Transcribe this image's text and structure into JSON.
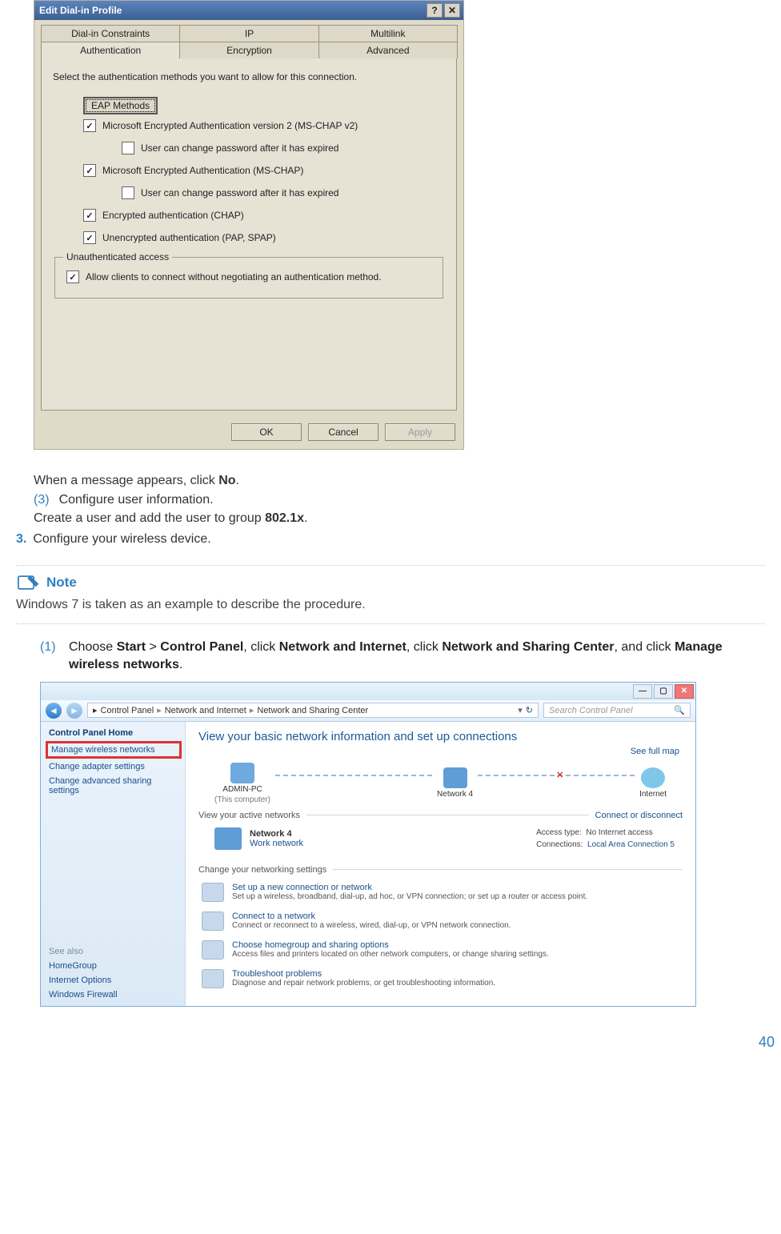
{
  "dialog": {
    "title": "Edit Dial-in Profile",
    "help_btn": "?",
    "close_btn": "✕",
    "tabs_row1": [
      "Dial-in Constraints",
      "IP",
      "Multilink"
    ],
    "tabs_row2": [
      "Authentication",
      "Encryption",
      "Advanced"
    ],
    "active_tab": "Authentication",
    "lead": "Select the authentication methods you want to allow for this connection.",
    "eap_button": "EAP Methods",
    "checks": [
      {
        "checked": true,
        "label": "Microsoft Encrypted Authentication version 2 (MS-CHAP v2)"
      },
      {
        "checked": false,
        "sub": true,
        "label": "User can change password after it has expired"
      },
      {
        "checked": true,
        "label": "Microsoft Encrypted Authentication (MS-CHAP)"
      },
      {
        "checked": false,
        "sub": true,
        "label": "User can change password after it has expired"
      },
      {
        "checked": true,
        "label": "Encrypted authentication (CHAP)"
      },
      {
        "checked": true,
        "label": "Unencrypted authentication (PAP, SPAP)"
      }
    ],
    "fieldset": {
      "legend": "Unauthenticated access",
      "check": {
        "checked": true,
        "label": "Allow clients to connect without negotiating an authentication method."
      }
    },
    "buttons": {
      "ok": "OK",
      "cancel": "Cancel",
      "apply": "Apply"
    }
  },
  "instr": {
    "line1_pre": "When a message appears, click ",
    "line1_bold": "No",
    "line1_post": ".",
    "p3_num": "(3)",
    "p3_text": "Configure user information.",
    "line3_pre": "Create a user and add the user to group ",
    "line3_bold": "802.1x",
    "line3_post": ".",
    "step3_num": "3.",
    "step3_text": "Configure your wireless device."
  },
  "note": {
    "label": "Note",
    "text": "Windows 7 is taken as an example to describe the procedure."
  },
  "step1": {
    "num": "(1)",
    "pre": "Choose ",
    "b1": "Start",
    "gt1": " > ",
    "b2": "Control Panel",
    "mid1": ", click ",
    "b3": "Network and Internet",
    "mid2": ", click ",
    "b4": "Network and Sharing Center",
    "mid3": ", and click ",
    "b5": "Manage wireless networks",
    "post": "."
  },
  "nsc": {
    "win": {
      "min": "—",
      "max": "▢",
      "close": "✕"
    },
    "crumbs": [
      "Control Panel",
      "Network and Internet",
      "Network and Sharing Center"
    ],
    "search_placeholder": "Search Control Panel",
    "refresh": "↻",
    "search_icon": "🔍",
    "sidebar": {
      "home": "Control Panel Home",
      "manage": "Manage wireless networks",
      "adapter": "Change adapter settings",
      "advanced": "Change advanced sharing settings",
      "seealso": "See also",
      "links": [
        "HomeGroup",
        "Internet Options",
        "Windows Firewall"
      ]
    },
    "main": {
      "h1": "View your basic network information and set up connections",
      "full_map": "See full map",
      "node_pc": "ADMIN-PC",
      "node_pc_sub": "(This computer)",
      "node_net": "Network  4",
      "node_internet": "Internet",
      "active_head": "View your active networks",
      "connect_link": "Connect or disconnect",
      "net_name": "Network  4",
      "net_type": "Work network",
      "access_k": "Access type:",
      "access_v": "No Internet access",
      "conn_k": "Connections:",
      "conn_v": "Local Area Connection 5",
      "change_head": "Change your networking settings",
      "items": [
        {
          "title": "Set up a new connection or network",
          "desc": "Set up a wireless, broadband, dial-up, ad hoc, or VPN connection; or set up a router or access point."
        },
        {
          "title": "Connect to a network",
          "desc": "Connect or reconnect to a wireless, wired, dial-up, or VPN network connection."
        },
        {
          "title": "Choose homegroup and sharing options",
          "desc": "Access files and printers located on other network computers, or change sharing settings."
        },
        {
          "title": "Troubleshoot problems",
          "desc": "Diagnose and repair network problems, or get troubleshooting information."
        }
      ]
    }
  },
  "page_number": "40"
}
